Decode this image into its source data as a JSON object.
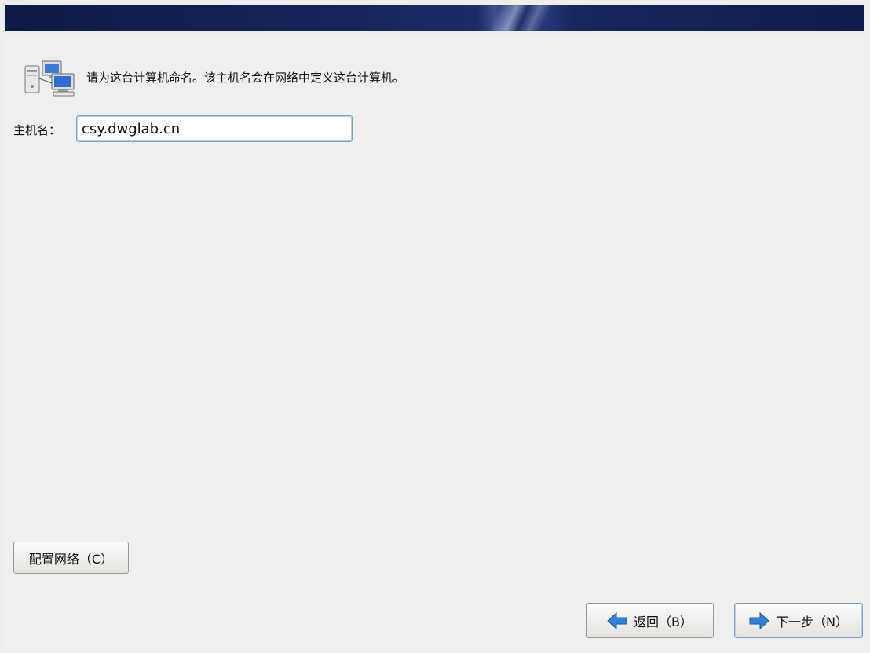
{
  "header": {
    "icon": "computer-network-icon"
  },
  "intro": {
    "text": "请为这台计算机命名。该主机名会在网络中定义这台计算机。"
  },
  "hostname": {
    "label": "主机名：",
    "value": "csy.dwglab.cn"
  },
  "buttons": {
    "configure_network": "配置网络（C）",
    "back": "返回（B）",
    "next": "下一步（N）"
  },
  "colors": {
    "banner": "#16245a",
    "arrow": "#2f7fd8",
    "focus_border": "#7fa0cf"
  }
}
